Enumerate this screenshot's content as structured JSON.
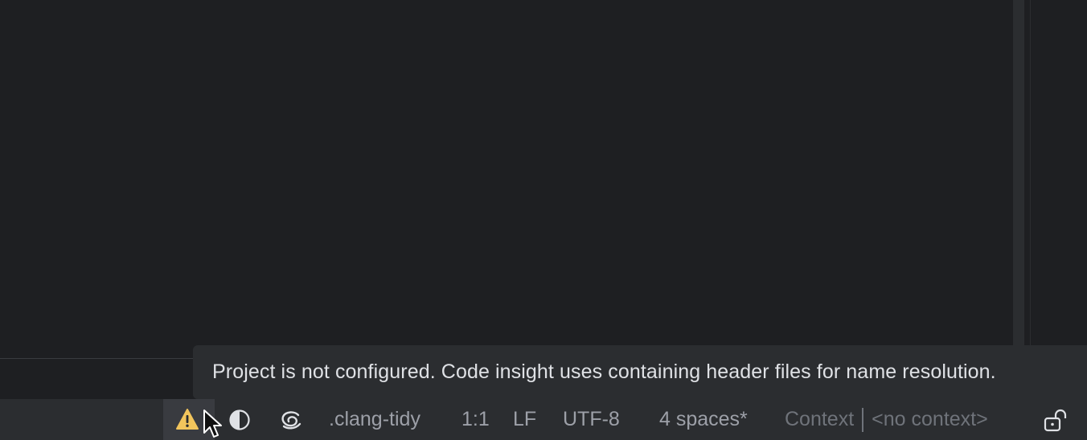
{
  "tooltip": {
    "text": "Project is not configured. Code insight uses containing header files for name resolution."
  },
  "status_bar": {
    "inspection_profile": ".clang-tidy",
    "caret_position": "1:1",
    "line_separator": "LF",
    "encoding": "UTF-8",
    "indent": "4 spaces*",
    "context_label": "Context",
    "context_value": "<no context>"
  },
  "icons": {
    "warning": "warning-icon",
    "theme": "contrast-icon",
    "ai": "ai-swirl-icon",
    "lock": "unlock-icon",
    "cursor": "mouse-pointer-icon"
  },
  "colors": {
    "warning": "#f2c55c",
    "status_text": "#9da0a8",
    "tooltip_bg": "#2b2d30",
    "editor_bg": "#1e1f22"
  }
}
